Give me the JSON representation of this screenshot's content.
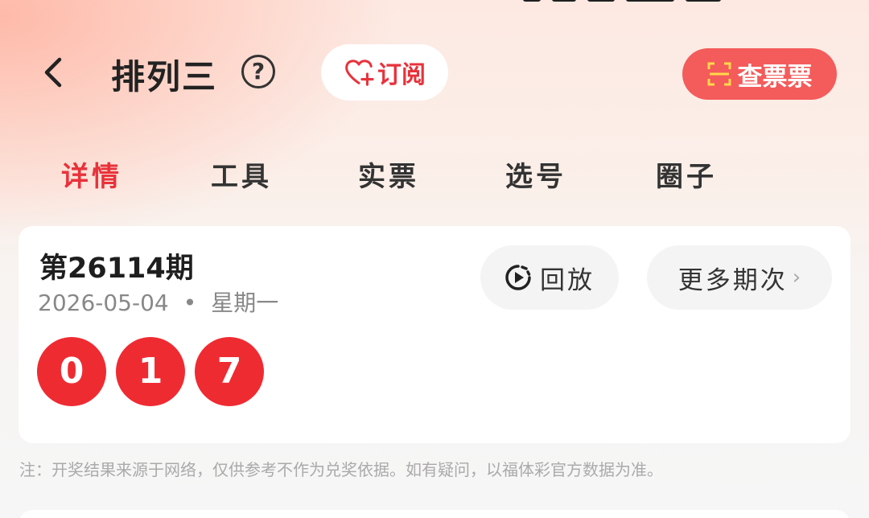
{
  "header": {
    "title": "排列三",
    "help_glyph": "?",
    "subscribe_label": "订阅",
    "ticket_check_label": "查票票"
  },
  "tabs": [
    {
      "label": "详情",
      "active": true
    },
    {
      "label": "工具",
      "active": false
    },
    {
      "label": "实票",
      "active": false
    },
    {
      "label": "选号",
      "active": false
    },
    {
      "label": "圈子",
      "active": false
    }
  ],
  "draw": {
    "issue_label": "第26114期",
    "date": "2026-05-04",
    "weekday": "星期一",
    "numbers": [
      "0",
      "1",
      "7"
    ],
    "replay_label": "回放",
    "more_issues_label": "更多期次"
  },
  "disclaimer": "注：开奖结果来源于网络，仅供参考不作为兑奖依据。如有疑问，以福体彩官方数据为准。",
  "colors": {
    "accent_red": "#e8323b",
    "ball_red": "#ef2b32",
    "ticket_button": "#f45b5b"
  },
  "icons": {
    "back": "chevron-left-icon",
    "help": "question-circle-icon",
    "subscribe": "heart-plus-icon",
    "ticket_check": "scan-icon",
    "replay": "replay-icon",
    "more": "chevron-right-icon"
  }
}
